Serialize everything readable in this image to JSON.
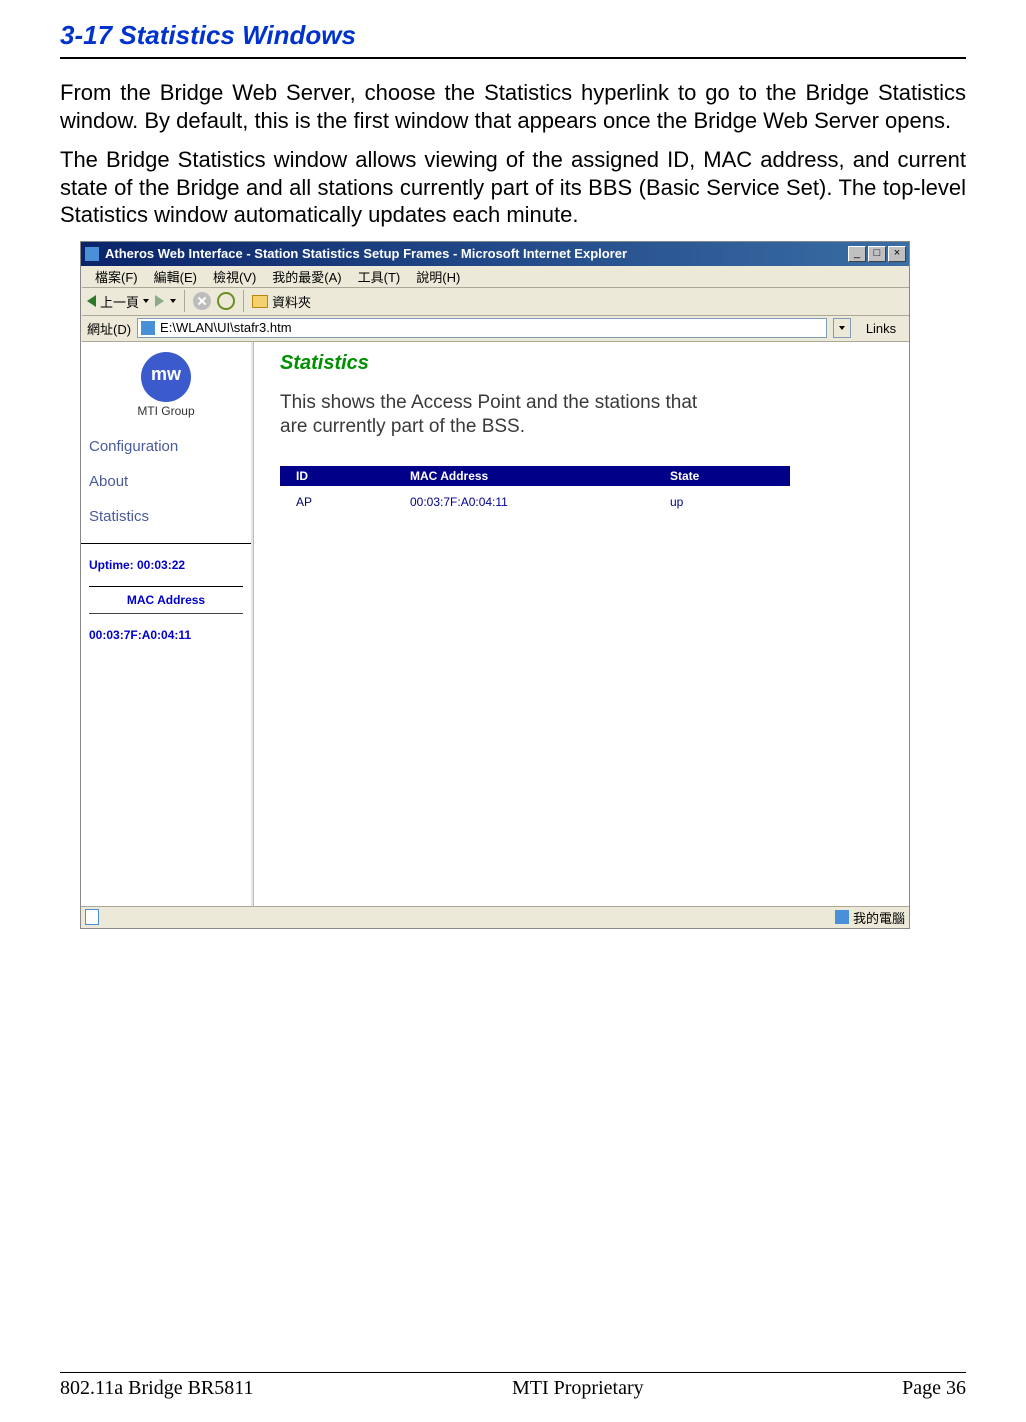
{
  "section_title": "3-17 Statistics Windows",
  "paragraphs": [
    "From the Bridge Web Server, choose the Statistics hyperlink to go to the Bridge Statistics window. By default, this is the first window that appears once the Bridge Web Server opens.",
    "The Bridge Statistics window allows viewing of the assigned ID, MAC address, and current state of the Bridge and all stations currently part of its BBS (Basic Service Set). The top-level Statistics window automatically updates each minute."
  ],
  "screenshot": {
    "window_title": "Atheros Web Interface - Station Statistics Setup Frames - Microsoft Internet Explorer",
    "menubar": {
      "file": "檔案(F)",
      "edit": "編輯(E)",
      "view": "檢視(V)",
      "favorites": "我的最愛(A)",
      "tools": "工具(T)",
      "help": "說明(H)"
    },
    "toolbar": {
      "back_label": "上一頁",
      "folders_label": "資料夾"
    },
    "addressbar": {
      "label": "網址(D)",
      "value": "E:\\WLAN\\UI\\stafr3.htm",
      "links_label": "Links"
    },
    "sidebar": {
      "logo_label": "MTI Group",
      "nav": {
        "configuration": "Configuration",
        "about": "About",
        "statistics": "Statistics"
      },
      "uptime": "Uptime: 00:03:22",
      "mac_title": "MAC Address",
      "mac_value": "00:03:7F:A0:04:11"
    },
    "content": {
      "title": "Statistics",
      "description": "This shows the Access Point and the stations that are currently part of the BSS.",
      "table": {
        "headers": {
          "id": "ID",
          "mac": "MAC Address",
          "state": "State"
        },
        "rows": [
          {
            "id": "AP",
            "mac": "00:03:7F:A0:04:11",
            "state": "up"
          }
        ]
      }
    },
    "statusbar": {
      "zone": "我的電腦"
    }
  },
  "footer": {
    "left": "802.11a Bridge BR5811",
    "center": "MTI Proprietary",
    "right": "Page 36"
  }
}
